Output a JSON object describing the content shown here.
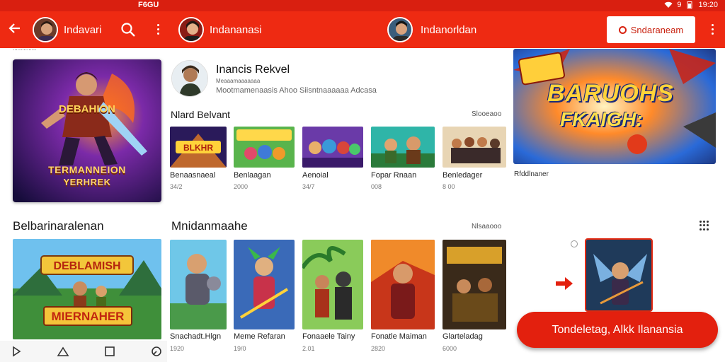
{
  "status_bar": {
    "carrier": "F6GU",
    "time": "19:20",
    "battery": "9"
  },
  "app_bar": {
    "back_icon": "arrow-left-icon",
    "user1": {
      "name": "Indavari"
    },
    "user2": {
      "name": "Indananasi"
    },
    "user3": {
      "name": "Indanorldan"
    },
    "subscribe_label": "Sndaraneam"
  },
  "left_column": {
    "small_label": "...............",
    "hero_caption_line1": "TERMANNEION",
    "hero_caption_line2": "YERHREK",
    "hero_title": "DEBAHION",
    "section_title": "Belbarinaralenan"
  },
  "channel": {
    "name": "Inancis Rekvel",
    "handle": "Meaaamaaaaaaa",
    "meta": "Mootmamenaasis  Ahoo Siisntnaaaaaa  Adcasa"
  },
  "section1": {
    "title": "Nlard Belvant",
    "more": "Slooeaoo",
    "tiles": [
      {
        "label": "Benaasnaeal",
        "sub": "34/2"
      },
      {
        "label": "Benlaagan",
        "sub": "2000"
      },
      {
        "label": "Aenoial",
        "sub": "34/7"
      },
      {
        "label": "Fopar Rnaan",
        "sub": "008"
      },
      {
        "label": "Benledager",
        "sub": "8 00"
      }
    ]
  },
  "hero_right": {
    "title_line1": "BARUOHS",
    "title_line2": "FKAIGH:",
    "label": "Rfddlnaner"
  },
  "section2": {
    "title": "Mnidanmaahe",
    "more": "Nlsaaooo",
    "tiles": [
      {
        "label": "Snachadt.Hlgn",
        "sub": "1920"
      },
      {
        "label": "Meme Refaran",
        "sub": "19/0"
      },
      {
        "label": "Fonaaele Tainy",
        "sub": "2.01"
      },
      {
        "label": "Fonatle Maiman",
        "sub": "2820"
      },
      {
        "label": "Glarteladag",
        "sub": "6000"
      }
    ]
  },
  "cta_label": "Tondeletag, Alkk Ilanansia",
  "colors": {
    "brand_red": "#ee2a12",
    "status_red": "#d91f10"
  }
}
